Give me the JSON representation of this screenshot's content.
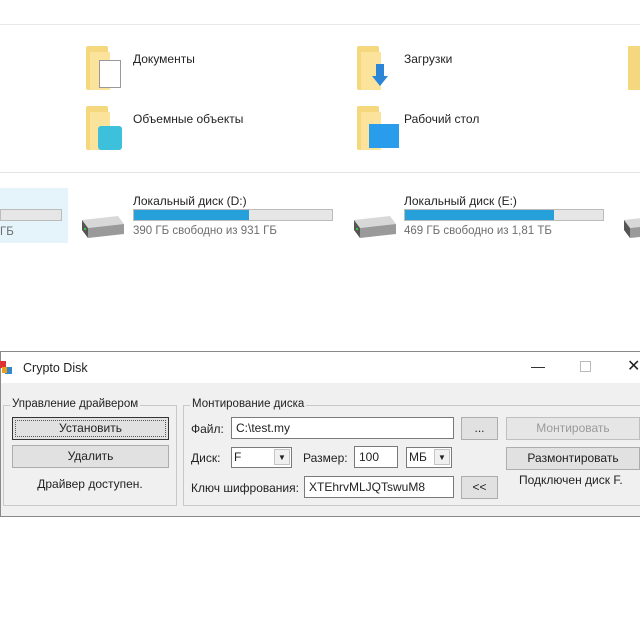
{
  "explorer": {
    "folders": [
      {
        "label": "Документы"
      },
      {
        "label": "Загрузки"
      },
      {
        "label": "Объемные объекты"
      },
      {
        "label": "Рабочий стол"
      }
    ],
    "drives": [
      {
        "label": "",
        "sub": "ГБ",
        "used_fraction": 0.0
      },
      {
        "label": "Локальный диск (D:)",
        "sub": "390 ГБ свободно из 931 ГБ",
        "used_fraction": 0.58
      },
      {
        "label": "Локальный диск (E:)",
        "sub": "469 ГБ свободно из 1,81 ТБ",
        "used_fraction": 0.75
      }
    ]
  },
  "window": {
    "title": "Crypto Disk",
    "driver_group": {
      "legend": "Управление драйвером",
      "install": "Установить",
      "remove": "Удалить",
      "status": "Драйвер доступен."
    },
    "mount_group": {
      "legend": "Монтирование диска",
      "file_label": "Файл:",
      "file_value": "C:\\test.my",
      "browse": "...",
      "mount": "Монтировать",
      "disk_label": "Диск:",
      "disk_value": "F",
      "size_label": "Размер:",
      "size_value": "100",
      "unit_value": "МБ",
      "unmount": "Размонтировать",
      "key_label": "Ключ шифрования:",
      "key_value": "XTEhrvMLJQTswuM8",
      "gen": "<<",
      "status": "Подключен диск F."
    }
  },
  "colors": {
    "accent": "#26a0da",
    "selection": "#e5f3fb"
  }
}
